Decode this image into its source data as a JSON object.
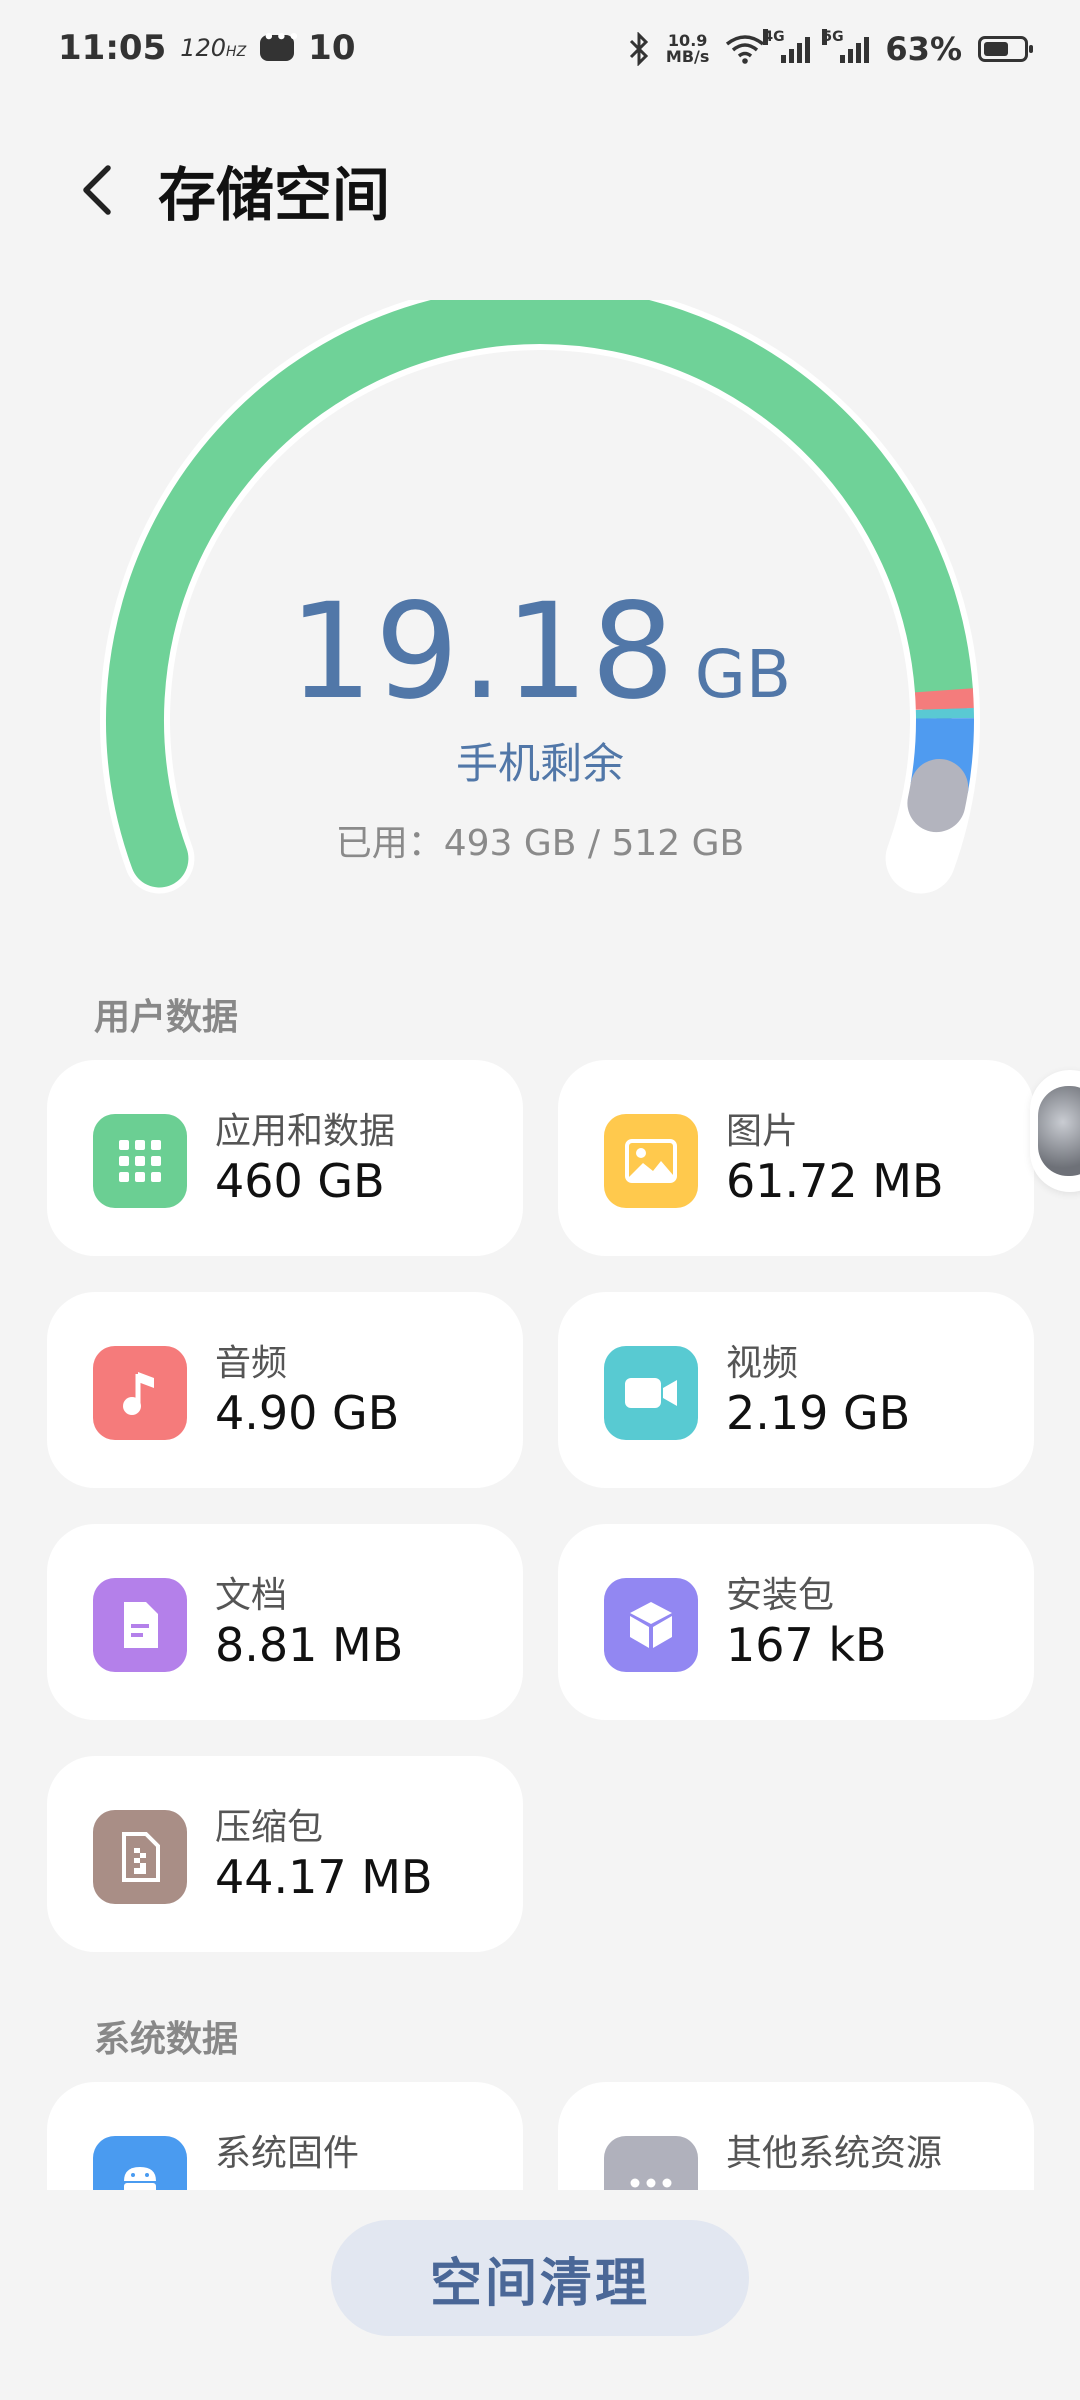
{
  "status_bar": {
    "time": "11:05",
    "refresh_rate": "120",
    "refresh_unit": "HZ",
    "notification_count": "10",
    "net_speed_value": "10.9",
    "net_speed_unit": "MB/s",
    "signal1_tag": "4G",
    "signal2_tag": "5G",
    "battery_percent": "63%",
    "battery_level": 0.63
  },
  "header": {
    "title": "存储空间"
  },
  "gauge": {
    "free_value": "19.18",
    "free_unit": "GB",
    "free_label": "手机剩余",
    "used_label": "已用：493 GB / 512 GB",
    "used_gb": 493,
    "total_gb": 512,
    "segment_colors": {
      "apps": "#6fd298",
      "audio": "#f47c7c",
      "video": "#5ac9d3",
      "system": "#4f9bf0",
      "other": "#b3b4be"
    }
  },
  "user_data": {
    "label": "用户数据",
    "items": [
      {
        "name": "应用和数据",
        "size": "460 GB",
        "icon": "apps-grid-icon",
        "color": "#6bcf93"
      },
      {
        "name": "图片",
        "size": "61.72 MB",
        "icon": "image-icon",
        "color": "#ffc94d"
      },
      {
        "name": "音频",
        "size": "4.90 GB",
        "icon": "music-note-icon",
        "color": "#f57b7b"
      },
      {
        "name": "视频",
        "size": "2.19 GB",
        "icon": "video-camera-icon",
        "color": "#58cad2"
      },
      {
        "name": "文档",
        "size": "8.81 MB",
        "icon": "document-icon",
        "color": "#b480ea"
      },
      {
        "name": "安装包",
        "size": "167 kB",
        "icon": "package-cube-icon",
        "color": "#9287f2"
      },
      {
        "name": "压缩包",
        "size": "44.17 MB",
        "icon": "zip-file-icon",
        "color": "#a98e86"
      }
    ]
  },
  "system_data": {
    "label": "系统数据",
    "items": [
      {
        "name": "系统固件",
        "icon": "android-icon",
        "color": "#4a9bf0"
      },
      {
        "name": "其他系统资源",
        "icon": "more-dots-icon",
        "color": "#b0b1bc"
      }
    ]
  },
  "clean_button": {
    "label": "空间清理"
  }
}
